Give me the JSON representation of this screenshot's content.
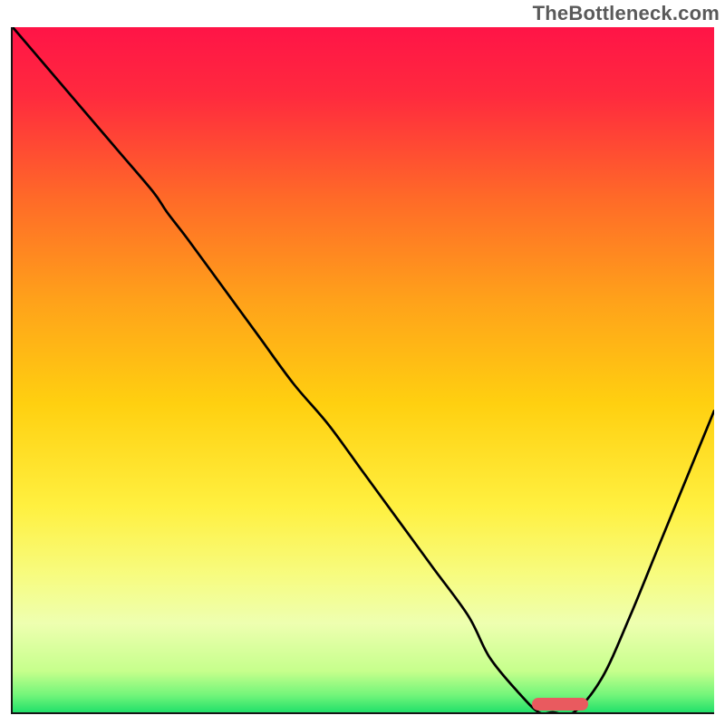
{
  "watermark": "TheBottleneck.com",
  "chart_data": {
    "type": "line",
    "title": "",
    "xlabel": "",
    "ylabel": "",
    "xlim": [
      0,
      100
    ],
    "ylim": [
      0,
      100
    ],
    "x": [
      0,
      5,
      10,
      15,
      20,
      22,
      25,
      30,
      35,
      40,
      45,
      50,
      55,
      60,
      65,
      68,
      72,
      75,
      77,
      80,
      84,
      88,
      92,
      96,
      100
    ],
    "values": [
      100,
      94,
      88,
      82,
      76,
      73,
      69,
      62,
      55,
      48,
      42,
      35,
      28,
      21,
      14,
      8,
      3,
      0,
      0,
      0,
      5,
      14,
      24,
      34,
      44
    ],
    "marker": {
      "x_start": 74,
      "x_end": 82,
      "y": 0,
      "color": "#e95a5f"
    },
    "gradient_stops": [
      {
        "pos": 0.0,
        "color": "#ff1447"
      },
      {
        "pos": 0.1,
        "color": "#ff2a3e"
      },
      {
        "pos": 0.25,
        "color": "#ff6a28"
      },
      {
        "pos": 0.4,
        "color": "#ffa21a"
      },
      {
        "pos": 0.55,
        "color": "#ffd010"
      },
      {
        "pos": 0.7,
        "color": "#fff040"
      },
      {
        "pos": 0.8,
        "color": "#f7fc80"
      },
      {
        "pos": 0.87,
        "color": "#eeffb0"
      },
      {
        "pos": 0.94,
        "color": "#c6ff8c"
      },
      {
        "pos": 0.975,
        "color": "#72f57a"
      },
      {
        "pos": 1.0,
        "color": "#22e06a"
      }
    ]
  }
}
